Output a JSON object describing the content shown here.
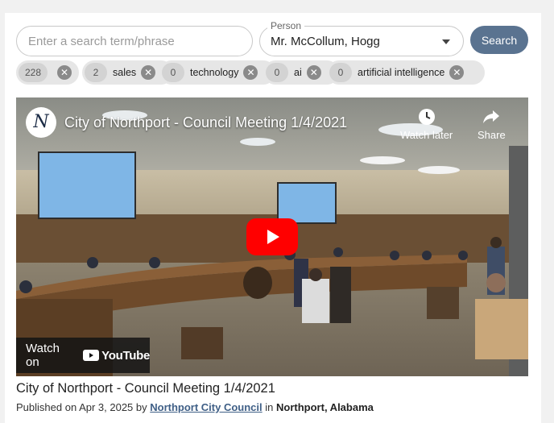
{
  "search": {
    "placeholder": "Enter a search term/phrase",
    "value": "",
    "button_label": "Search"
  },
  "person": {
    "legend": "Person",
    "selected": "Mr. McCollum, Hogg"
  },
  "chips": [
    {
      "count": "228",
      "label": ""
    },
    {
      "count": "2",
      "label": "sales"
    },
    {
      "count": "0",
      "label": "technology"
    },
    {
      "count": "0",
      "label": "ai"
    },
    {
      "count": "0",
      "label": "artificial intelligence"
    }
  ],
  "video": {
    "title": "City of Northport - Council Meeting 1/4/2021",
    "logo_letter": "N",
    "watch_later": "Watch later",
    "share": "Share",
    "watch_on": "Watch on",
    "youtube": "YouTube"
  },
  "meeting": {
    "title": "City of Northport - Council Meeting 1/4/2021",
    "published_prefix": "Published on Apr 3, 2025 by",
    "publisher": "Northport City Council",
    "in_word": "in",
    "location": "Northport, Alabama"
  },
  "colors": {
    "search_button": "#5a7390",
    "play_button": "#ff0000",
    "link": "#3f5f86"
  }
}
